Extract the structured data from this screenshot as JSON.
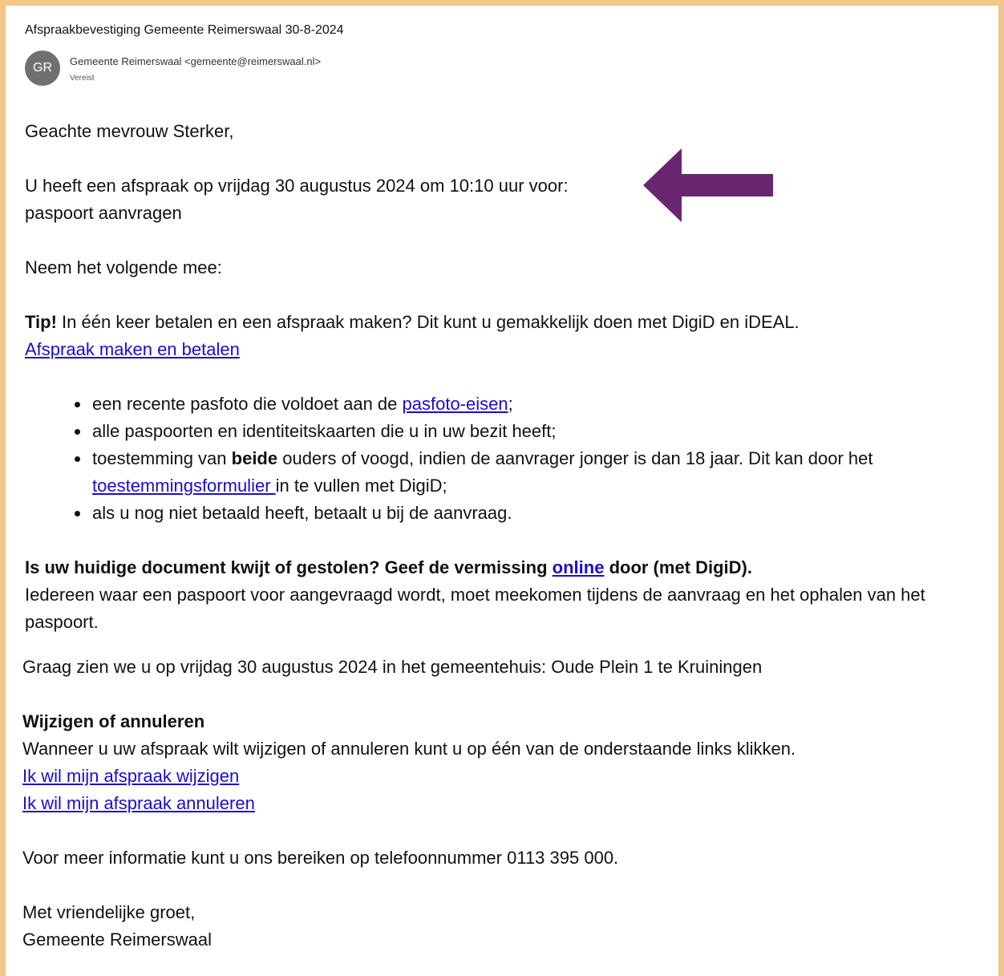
{
  "email": {
    "subject": "Afspraakbevestiging Gemeente Reimerswaal 30-8-2024",
    "avatar_initials": "GR",
    "sender": "Gemeente Reimerswaal <gemeente@reimerswaal.nl>",
    "sender_sub": "Vereist"
  },
  "colors": {
    "accent_arrow": "#6a2570",
    "link": "#1a0dcc",
    "border": "#f4c68a",
    "avatar": "#707070"
  },
  "body": {
    "greeting": "Geachte mevrouw Sterker,",
    "appointment_line": "U heeft een afspraak op vrijdag 30 augustus 2024 om 10:10 uur voor:",
    "service": "paspoort aanvragen",
    "bring": "Neem het volgende mee:",
    "tip_bold": "Tip!",
    "tip_text": " In één keer betalen en een afspraak maken? Dit kunt u gemakkelijk doen met DigiD en iDEAL.",
    "tip_link": "Afspraak maken en betalen ",
    "list": {
      "item1_pre": "een recente pasfoto die voldoet aan de ",
      "item1_link": "pasfoto-eisen",
      "item1_post": ";",
      "item2": "alle paspoorten en identiteitskaarten die u in uw bezit heeft;",
      "item3_pre": "toestemming van ",
      "item3_bold": "beide",
      "item3_mid": " ouders of voogd, indien de aanvrager jonger is dan 18 jaar. Dit kan door het ",
      "item3_link": "toestemmingsformulier ",
      "item3_post": "in te vullen met DigiD;",
      "item4": "als u nog niet betaald heeft, betaalt u bij de aanvraag."
    },
    "lost_pre": "Is uw huidige document kwijt of gestolen? Geef de vermissing ",
    "lost_link": "online",
    "lost_post": " door (met DigiD).",
    "everyone": "Iedereen waar een paspoort voor aangevraagd wordt, moet meekomen tijdens de aanvraag en het ophalen van het paspoort.",
    "see_you": "Graag zien we u op vrijdag 30 augustus 2024 in het gemeentehuis: Oude Plein 1 te Kruiningen",
    "change_heading": "Wijzigen of annuleren",
    "change_text": "Wanneer u uw afspraak wilt wijzigen of annuleren kunt u op één van de onderstaande links klikken.",
    "change_link": "Ik wil mijn afspraak wijzigen",
    "cancel_link": "Ik wil mijn afspraak annuleren",
    "info": "Voor meer informatie kunt u ons bereiken op telefoonnummer 0113 395 000.",
    "closing": "Met vriendelijke groet,",
    "signature": "Gemeente Reimerswaal"
  }
}
